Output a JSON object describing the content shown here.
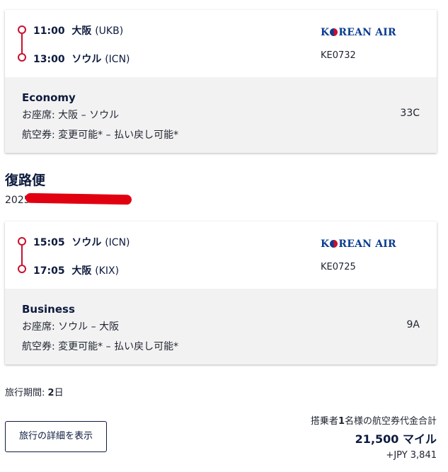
{
  "outbound": {
    "departure": {
      "time": "11:00",
      "city": "大阪",
      "code": "(UKB)"
    },
    "arrival": {
      "time": "13:00",
      "city": "ソウル",
      "code": "(ICN)"
    },
    "airline": "KOREAN AIR",
    "flight_number": "KE0732",
    "cabin": "Economy",
    "seat_label": "お座席:",
    "seat_route": "大阪 – ソウル",
    "seat": "33C",
    "ticket_label": "航空券:",
    "ticket_rules": "変更可能* – 払い戻し可能*"
  },
  "return_section": {
    "title": "復路便",
    "date_visible": "2025"
  },
  "inbound": {
    "departure": {
      "time": "15:05",
      "city": "ソウル",
      "code": "(ICN)"
    },
    "arrival": {
      "time": "17:05",
      "city": "大阪",
      "code": "(KIX)"
    },
    "airline": "KOREAN AIR",
    "flight_number": "KE0725",
    "cabin": "Business",
    "seat_label": "お座席:",
    "seat_route": "ソウル – 大阪",
    "seat": "9A",
    "ticket_label": "航空券:",
    "ticket_rules": "変更可能* – 払い戻し可能*"
  },
  "trip": {
    "duration_label": "旅行期間:",
    "duration_value": "2",
    "duration_unit": "日"
  },
  "detail_button": "旅行の詳細を表示",
  "total": {
    "label_prefix": "搭乗者",
    "label_count": "1",
    "label_suffix": "名様の航空券代金合計",
    "miles": "21,500 マイル",
    "jpy": "+JPY 3,841"
  },
  "colors": {
    "accent": "#c8102e",
    "navy": "#0d1b3e",
    "logo_blue": "#0b3d91",
    "redaction": "#e10010"
  }
}
